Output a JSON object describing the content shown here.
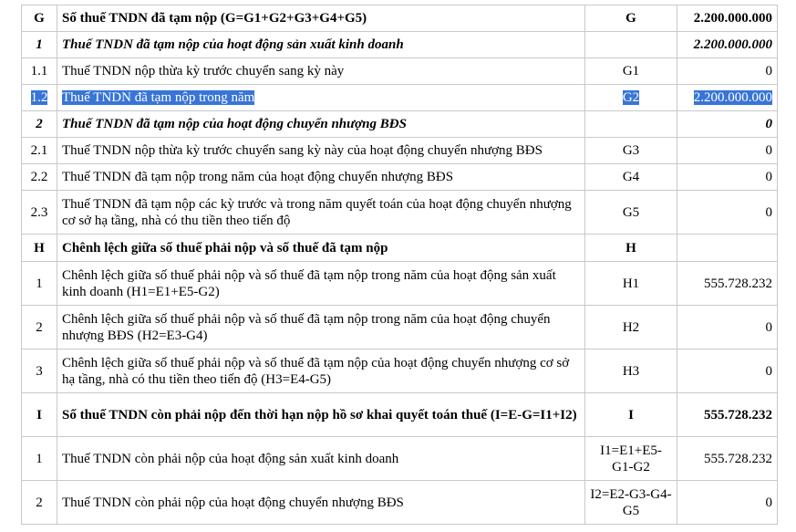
{
  "rows": [
    {
      "stt": "G",
      "desc": "Số thuế TNDN đã tạm nộp (G=G1+G2+G3+G4+G5)",
      "code": "G",
      "amount": "2.200.000.000"
    },
    {
      "stt": "1",
      "desc": "Thuế TNDN đã tạm nộp của hoạt động sản xuất kinh doanh",
      "code": "",
      "amount": "2.200.000.000"
    },
    {
      "stt": "1.1",
      "desc": "Thuế TNDN nộp thừa kỳ trước chuyển sang kỳ này",
      "code": "G1",
      "amount": "0"
    },
    {
      "stt": "1.2",
      "desc": "Thuế TNDN đã tạm nộp trong năm",
      "code": "G2",
      "amount": "2.200.000.000"
    },
    {
      "stt": "2",
      "desc": "Thuế TNDN đã tạm nộp của hoạt động chuyển nhượng BĐS",
      "code": "",
      "amount": "0"
    },
    {
      "stt": "2.1",
      "desc": "Thuế TNDN nộp thừa kỳ trước chuyển sang kỳ này của hoạt động chuyển nhượng BĐS",
      "code": "G3",
      "amount": "0"
    },
    {
      "stt": "2.2",
      "desc": "Thuế TNDN đã tạm nộp trong năm của hoạt động chuyển nhượng BĐS",
      "code": "G4",
      "amount": "0"
    },
    {
      "stt": "2.3",
      "desc": "Thuế TNDN đã tạm nộp các kỳ trước và trong năm quyết toán của hoạt động chuyển nhượng cơ sở hạ tầng, nhà có thu tiền theo tiến độ",
      "code": "G5",
      "amount": "0"
    },
    {
      "stt": "H",
      "desc": "Chênh lệch giữa số thuế phải nộp và số thuế đã tạm nộp",
      "code": "H",
      "amount": ""
    },
    {
      "stt": "1",
      "desc": "Chênh lệch giữa số thuế phải nộp và số thuế đã tạm nộp trong năm của hoạt động sản xuất kinh doanh (H1=E1+E5-G2)",
      "code": "H1",
      "amount": "555.728.232"
    },
    {
      "stt": "2",
      "desc": "Chênh lệch giữa số thuế phải nộp và số thuế đã tạm nộp trong năm của hoạt động chuyển nhượng BĐS (H2=E3-G4)",
      "code": "H2",
      "amount": "0"
    },
    {
      "stt": "3",
      "desc": "Chênh lệch giữa số thuế phải nộp và số thuế đã tạm nộp của hoạt động chuyển nhượng cơ sở hạ tầng, nhà có thu tiền theo tiến độ (H3=E4-G5)",
      "code": "H3",
      "amount": "0"
    },
    {
      "stt": "I",
      "desc": "Số thuế TNDN còn phải nộp đến thời hạn nộp hồ sơ khai quyết toán thuế (I=E-G=I1+I2)",
      "code": "I",
      "amount": "555.728.232"
    },
    {
      "stt": "1",
      "desc": "Thuế TNDN còn phải nộp của hoạt động sản xuất kinh doanh",
      "code": "I1=E1+E5-G1-G2",
      "amount": "555.728.232"
    },
    {
      "stt": "2",
      "desc": "Thuế TNDN còn phải nộp của hoạt động chuyển nhượng BĐS",
      "code": "I2=E2-G3-G4-G5",
      "amount": "0"
    }
  ],
  "colors": {
    "selection": "#3875d7",
    "border": "#c9c9c9"
  }
}
